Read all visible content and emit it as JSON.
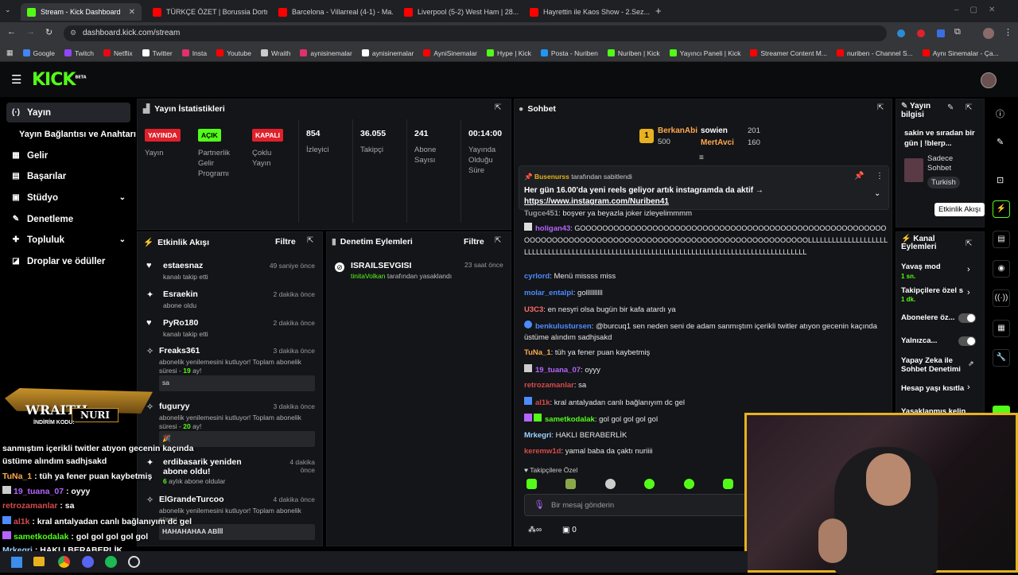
{
  "browser": {
    "tabs": [
      {
        "title": "Stream - Kick Dashboard",
        "color": "#53fc18",
        "active": true
      },
      {
        "title": "TÜRKÇE ÖZET | Borussia Dortm...",
        "color": "#ff0000"
      },
      {
        "title": "Barcelona - Villarreal (4-1) - Ma...",
        "color": "#ff0000"
      },
      {
        "title": "Liverpool (5-2) West Ham | 28...",
        "color": "#ff0000"
      },
      {
        "title": "Hayrettin ile Kaos Show - 2.Sez...",
        "color": "#ff0000"
      }
    ],
    "url": "dashboard.kick.com/stream",
    "bookmarks": [
      {
        "label": "Google",
        "color": "#4285f4"
      },
      {
        "label": "Twitch",
        "color": "#9146ff"
      },
      {
        "label": "Netflix",
        "color": "#e50914"
      },
      {
        "label": "Twitter",
        "color": "#ffffff"
      },
      {
        "label": "Insta",
        "color": "#e1306c"
      },
      {
        "label": "Youtube",
        "color": "#ff0000"
      },
      {
        "label": "Wraith",
        "color": "#cccccc"
      },
      {
        "label": "aynisinemalar",
        "color": "#e1306c"
      },
      {
        "label": "aynisinemalar",
        "color": "#ffffff"
      },
      {
        "label": "AyniSinemalar",
        "color": "#ff0000"
      },
      {
        "label": "Hype | Kick",
        "color": "#53fc18"
      },
      {
        "label": "Posta - Nuriben",
        "color": "#2196f3"
      },
      {
        "label": "Nuriben | Kick",
        "color": "#53fc18"
      },
      {
        "label": "Yayıncı Paneli | Kick",
        "color": "#53fc18"
      },
      {
        "label": "Streamer Content M...",
        "color": "#ff0000"
      },
      {
        "label": "nuriben - Channel S...",
        "color": "#ff0000"
      },
      {
        "label": "Aynı Sinemalar - Ça...",
        "color": "#ff0000"
      }
    ]
  },
  "header": {
    "logo": "KICK",
    "beta": "BETA"
  },
  "sidebar": {
    "items": [
      {
        "label": "Yayın",
        "icon": "(·)"
      },
      {
        "label": "Yayın Bağlantısı ve Anahtarı",
        "icon": ""
      },
      {
        "label": "Gelir",
        "icon": "▦"
      },
      {
        "label": "Başarılar",
        "icon": "▤"
      },
      {
        "label": "Stüdyo",
        "icon": "▣"
      },
      {
        "label": "Denetleme",
        "icon": "✎"
      },
      {
        "label": "Topluluk",
        "icon": "✚"
      },
      {
        "label": "Droplar ve ödüller",
        "icon": "◪"
      }
    ]
  },
  "stats": {
    "title": "Yayın İstatistikleri",
    "badges": [
      {
        "badge": "YAYINDA",
        "label": "Yayın",
        "color": "#e0212b"
      },
      {
        "badge": "AÇIK",
        "label": "Partnerlik Gelir Programı",
        "color": "#53fc18"
      },
      {
        "badge": "KAPALI",
        "label": "Çoklu Yayın",
        "color": "#e0212b"
      }
    ],
    "numbers": [
      {
        "value": "854",
        "label": "İzleyici"
      },
      {
        "value": "36.055",
        "label": "Takipçi"
      },
      {
        "value": "241",
        "label": "Abone Sayısı"
      },
      {
        "value": "00:14:00",
        "label": "Yayında Olduğu Süre"
      }
    ]
  },
  "activity": {
    "title": "Etkinlik Akışı",
    "filter": "Filtre",
    "events": [
      {
        "name": "estaesnaz",
        "sub": "kanalı takip etti",
        "time": "49 saniye önce",
        "icon": "♥"
      },
      {
        "name": "Esraekin",
        "sub": "abone oldu",
        "time": "2 dakika önce",
        "icon": "✦"
      },
      {
        "name": "PyRo180",
        "sub": "kanalı takip etti",
        "time": "2 dakika önce",
        "icon": "♥"
      },
      {
        "name": "Freaks361",
        "sub": "abonelik yenilemesini kutluyor! Toplam abonelik süresi - ",
        "months": "19",
        "suffix": " ay!",
        "time": "3 dakika önce",
        "msg": "sa",
        "icon": "✧"
      },
      {
        "name": "fuguryy",
        "sub": "abonelik yenilemesini kutluyor! Toplam abonelik süresi - ",
        "months": "20",
        "suffix": " ay!",
        "time": "3 dakika önce",
        "msg": "🎉",
        "icon": "✧"
      },
      {
        "name": "erdibasarik yeniden abone oldu!",
        "sub": "6",
        "suffix": " aylık abone oldular",
        "time": "4 dakika önce",
        "icon": "✦"
      },
      {
        "name": "ElGrandeTurcoo",
        "sub": "abonelik yenilemesini kutluyor! Toplam abonelik süresi - ",
        "time": "4 dakika önce",
        "msg": "HAHAHAHAA ABİİİ",
        "icon": "✧"
      }
    ]
  },
  "moderation": {
    "title": "Denetim Eylemleri",
    "filter": "Filtre",
    "items": [
      {
        "user": "ISRAILSEVGISI",
        "by": "tinitaVolkan",
        "text": " tarafından yasaklandı",
        "time": "23 saat önce"
      }
    ]
  },
  "chat": {
    "title": "Sohbet",
    "top": [
      {
        "name": "BerkanAbi",
        "value": "500",
        "rank": "1"
      },
      {
        "name": "sowien",
        "value": "201"
      },
      {
        "name": "MertAvci",
        "value": "160"
      }
    ],
    "pinned": {
      "by": "Busenurss",
      "by_suffix": " tarafından sabitlendi",
      "text": "Her gün 16.00'da yeni reels geliyor artık instagramda da aktif →",
      "link": "https://www.instagram.com/Nuriben41"
    },
    "messages": [
      {
        "user": "Tugce451",
        "color": "#9c9c9c",
        "text": ": boşver ya beyazla joker izleyelimmmm"
      },
      {
        "user": "holigan43",
        "color": "#b565ff",
        "text": ": GOOOOOOOOOOOOOOOOOOOOOOOOOOOOOOOOOOOOOOOOOOOOOOOOOOOOOOOOOOOOOOOOOOOOOOOOOOOOOOOOOOOOOOOOOOOOOOOOOOOOOOOOOOLLLLLLLLLLLLLLLLLLLLLLLLLLLLLLLLLLLLLLLLLLLLLLLLLLLLLLLLLLLLLLLLLLLLLLLLLLLLLLLLLLLLLLLLLLL"
      },
      {
        "user": "cyrlord",
        "color": "#4d8bff",
        "text": ": Menü missss miss"
      },
      {
        "user": "molar_entalpi",
        "color": "#4d8bff",
        "text": ": gollllllllll"
      },
      {
        "user": "U3C3",
        "color": "#ff6b6b",
        "text": ": en nesyri olsa bugün bir kafa atardı ya"
      },
      {
        "user": "benkulustursen",
        "color": "#4d8bff",
        "text": ": @burcuq1 sen neden seni de adam sanmıştım içerikli twitler atıyon gecenin kaçında üstüme alındım sadhjsakd"
      },
      {
        "user": "TuNa_1",
        "color": "#ffa94d",
        "text": ": tüh ya fener puan kaybetmiş"
      },
      {
        "user": "19_tuana_07",
        "color": "#b565ff",
        "text": ": oyyy"
      },
      {
        "user": "retrozamanlar",
        "color": "#d64b4b",
        "text": ": sa"
      },
      {
        "user": "al1k",
        "color": "#d64b4b",
        "text": ": kral antalyadan canlı bağlanıyım dc gel"
      },
      {
        "user": "sametkodalak",
        "color": "#53fc18",
        "text": ": gol gol gol gol gol"
      },
      {
        "user": "Mrkegri",
        "color": "#9cd3ff",
        "text": ": HAKLI BERABERLİK"
      },
      {
        "user": "keremw1d",
        "color": "#d64b4b",
        "text": ": yamal baba da çaktı nuriiii"
      }
    ],
    "followers_only": "Takipçilere Özel",
    "input_placeholder": "Bir mesaj gönderin",
    "points": "0"
  },
  "streaminfo": {
    "title": "Yayın bilgisi",
    "text": "sakin ve sıradan bir gün | !blerp...",
    "mode": "Sadece Sohbet",
    "lang": "Turkish"
  },
  "channel": {
    "title": "Kanal Eylemleri",
    "items": [
      {
        "label": "Yavaş mod",
        "sub": "1 sn."
      },
      {
        "label": "Takipçilere özel s",
        "sub": "1 dk."
      },
      {
        "label": "Abonelere öz..."
      },
      {
        "label": "Yalnızca..."
      },
      {
        "label": "Yapay Zeka ile Sohbet Denetimi"
      },
      {
        "label": "Hesap yaşı kısıtla"
      },
      {
        "label": "Yasaklanmış kelin"
      }
    ],
    "tooltip": "Etkinlik Akışı"
  },
  "overlay": {
    "brand": "WRAITH.",
    "code_label": "İNDİRİM KODU:",
    "code": "NURI",
    "lines": [
      {
        "user": "",
        "text": "sanmıştım içerikli twitler atıyon gecenin kaçında"
      },
      {
        "user": "",
        "text": "üstüme alındım sadhjsakd"
      },
      {
        "user": "TuNa_1",
        "text": " : tüh ya fener puan kaybetmiş",
        "color": "#ffa94d"
      },
      {
        "user": "19_tuana_07",
        "text": " : oyyy",
        "color": "#b565ff"
      },
      {
        "user": "retrozamanlar",
        "text": " : sa",
        "color": "#d64b4b"
      },
      {
        "user": "al1k",
        "text": " : kral antalyadan canlı bağlanıyım dc gel",
        "color": "#d64b4b"
      },
      {
        "user": "sametkodalak",
        "text": " : gol gol gol gol gol",
        "color": "#53fc18"
      },
      {
        "user": "Mrkegri",
        "text": " : HAKLI BERABERLİK",
        "color": "#9cd3ff"
      }
    ]
  }
}
